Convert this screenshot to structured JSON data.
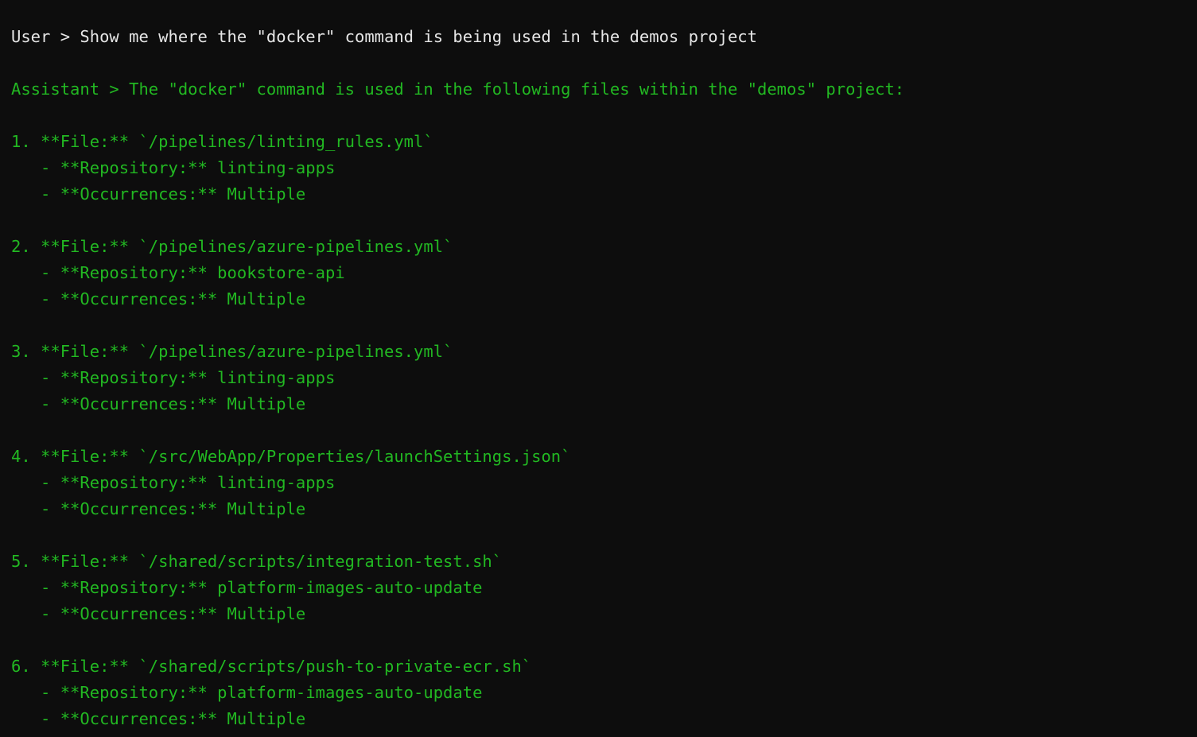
{
  "terminal": {
    "background_color": "#0d0d0d",
    "user_text_color": "#e6e6e6",
    "assistant_text_color": "#22b822",
    "user_line": "User > Show me where the \"docker\" command is being used in the demos project",
    "assistant_line": "Assistant > The \"docker\" command is used in the following files within the \"demos\" project:",
    "results": [
      {
        "file_line": "1. **File:** `/pipelines/linting_rules.yml`",
        "repository_line": "   - **Repository:** linting-apps",
        "occurrences_line": "   - **Occurrences:** Multiple",
        "index": "1",
        "file": "/pipelines/linting_rules.yml",
        "repository": "linting-apps",
        "occurrences": "Multiple"
      },
      {
        "file_line": "2. **File:** `/pipelines/azure-pipelines.yml`",
        "repository_line": "   - **Repository:** bookstore-api",
        "occurrences_line": "   - **Occurrences:** Multiple",
        "index": "2",
        "file": "/pipelines/azure-pipelines.yml",
        "repository": "bookstore-api",
        "occurrences": "Multiple"
      },
      {
        "file_line": "3. **File:** `/pipelines/azure-pipelines.yml`",
        "repository_line": "   - **Repository:** linting-apps",
        "occurrences_line": "   - **Occurrences:** Multiple",
        "index": "3",
        "file": "/pipelines/azure-pipelines.yml",
        "repository": "linting-apps",
        "occurrences": "Multiple"
      },
      {
        "file_line": "4. **File:** `/src/WebApp/Properties/launchSettings.json`",
        "repository_line": "   - **Repository:** linting-apps",
        "occurrences_line": "   - **Occurrences:** Multiple",
        "index": "4",
        "file": "/src/WebApp/Properties/launchSettings.json",
        "repository": "linting-apps",
        "occurrences": "Multiple"
      },
      {
        "file_line": "5. **File:** `/shared/scripts/integration-test.sh`",
        "repository_line": "   - **Repository:** platform-images-auto-update",
        "occurrences_line": "   - **Occurrences:** Multiple",
        "index": "5",
        "file": "/shared/scripts/integration-test.sh",
        "repository": "platform-images-auto-update",
        "occurrences": "Multiple"
      },
      {
        "file_line": "6. **File:** `/shared/scripts/push-to-private-ecr.sh`",
        "repository_line": "   - **Repository:** platform-images-auto-update",
        "occurrences_line": "   - **Occurrences:** Multiple",
        "index": "6",
        "file": "/shared/scripts/push-to-private-ecr.sh",
        "repository": "platform-images-auto-update",
        "occurrences": "Multiple"
      }
    ]
  }
}
